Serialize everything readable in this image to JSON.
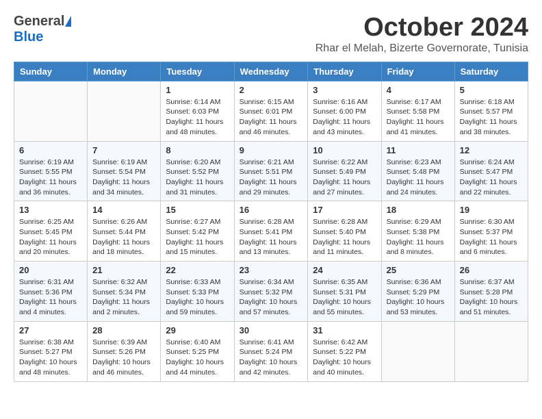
{
  "header": {
    "logo_general": "General",
    "logo_blue": "Blue",
    "month": "October 2024",
    "location": "Rhar el Melah, Bizerte Governorate, Tunisia"
  },
  "weekdays": [
    "Sunday",
    "Monday",
    "Tuesday",
    "Wednesday",
    "Thursday",
    "Friday",
    "Saturday"
  ],
  "weeks": [
    [
      {
        "day": "",
        "info": ""
      },
      {
        "day": "",
        "info": ""
      },
      {
        "day": "1",
        "info": "Sunrise: 6:14 AM\nSunset: 6:03 PM\nDaylight: 11 hours and 48 minutes."
      },
      {
        "day": "2",
        "info": "Sunrise: 6:15 AM\nSunset: 6:01 PM\nDaylight: 11 hours and 46 minutes."
      },
      {
        "day": "3",
        "info": "Sunrise: 6:16 AM\nSunset: 6:00 PM\nDaylight: 11 hours and 43 minutes."
      },
      {
        "day": "4",
        "info": "Sunrise: 6:17 AM\nSunset: 5:58 PM\nDaylight: 11 hours and 41 minutes."
      },
      {
        "day": "5",
        "info": "Sunrise: 6:18 AM\nSunset: 5:57 PM\nDaylight: 11 hours and 38 minutes."
      }
    ],
    [
      {
        "day": "6",
        "info": "Sunrise: 6:19 AM\nSunset: 5:55 PM\nDaylight: 11 hours and 36 minutes."
      },
      {
        "day": "7",
        "info": "Sunrise: 6:19 AM\nSunset: 5:54 PM\nDaylight: 11 hours and 34 minutes."
      },
      {
        "day": "8",
        "info": "Sunrise: 6:20 AM\nSunset: 5:52 PM\nDaylight: 11 hours and 31 minutes."
      },
      {
        "day": "9",
        "info": "Sunrise: 6:21 AM\nSunset: 5:51 PM\nDaylight: 11 hours and 29 minutes."
      },
      {
        "day": "10",
        "info": "Sunrise: 6:22 AM\nSunset: 5:49 PM\nDaylight: 11 hours and 27 minutes."
      },
      {
        "day": "11",
        "info": "Sunrise: 6:23 AM\nSunset: 5:48 PM\nDaylight: 11 hours and 24 minutes."
      },
      {
        "day": "12",
        "info": "Sunrise: 6:24 AM\nSunset: 5:47 PM\nDaylight: 11 hours and 22 minutes."
      }
    ],
    [
      {
        "day": "13",
        "info": "Sunrise: 6:25 AM\nSunset: 5:45 PM\nDaylight: 11 hours and 20 minutes."
      },
      {
        "day": "14",
        "info": "Sunrise: 6:26 AM\nSunset: 5:44 PM\nDaylight: 11 hours and 18 minutes."
      },
      {
        "day": "15",
        "info": "Sunrise: 6:27 AM\nSunset: 5:42 PM\nDaylight: 11 hours and 15 minutes."
      },
      {
        "day": "16",
        "info": "Sunrise: 6:28 AM\nSunset: 5:41 PM\nDaylight: 11 hours and 13 minutes."
      },
      {
        "day": "17",
        "info": "Sunrise: 6:28 AM\nSunset: 5:40 PM\nDaylight: 11 hours and 11 minutes."
      },
      {
        "day": "18",
        "info": "Sunrise: 6:29 AM\nSunset: 5:38 PM\nDaylight: 11 hours and 8 minutes."
      },
      {
        "day": "19",
        "info": "Sunrise: 6:30 AM\nSunset: 5:37 PM\nDaylight: 11 hours and 6 minutes."
      }
    ],
    [
      {
        "day": "20",
        "info": "Sunrise: 6:31 AM\nSunset: 5:36 PM\nDaylight: 11 hours and 4 minutes."
      },
      {
        "day": "21",
        "info": "Sunrise: 6:32 AM\nSunset: 5:34 PM\nDaylight: 11 hours and 2 minutes."
      },
      {
        "day": "22",
        "info": "Sunrise: 6:33 AM\nSunset: 5:33 PM\nDaylight: 10 hours and 59 minutes."
      },
      {
        "day": "23",
        "info": "Sunrise: 6:34 AM\nSunset: 5:32 PM\nDaylight: 10 hours and 57 minutes."
      },
      {
        "day": "24",
        "info": "Sunrise: 6:35 AM\nSunset: 5:31 PM\nDaylight: 10 hours and 55 minutes."
      },
      {
        "day": "25",
        "info": "Sunrise: 6:36 AM\nSunset: 5:29 PM\nDaylight: 10 hours and 53 minutes."
      },
      {
        "day": "26",
        "info": "Sunrise: 6:37 AM\nSunset: 5:28 PM\nDaylight: 10 hours and 51 minutes."
      }
    ],
    [
      {
        "day": "27",
        "info": "Sunrise: 6:38 AM\nSunset: 5:27 PM\nDaylight: 10 hours and 48 minutes."
      },
      {
        "day": "28",
        "info": "Sunrise: 6:39 AM\nSunset: 5:26 PM\nDaylight: 10 hours and 46 minutes."
      },
      {
        "day": "29",
        "info": "Sunrise: 6:40 AM\nSunset: 5:25 PM\nDaylight: 10 hours and 44 minutes."
      },
      {
        "day": "30",
        "info": "Sunrise: 6:41 AM\nSunset: 5:24 PM\nDaylight: 10 hours and 42 minutes."
      },
      {
        "day": "31",
        "info": "Sunrise: 6:42 AM\nSunset: 5:22 PM\nDaylight: 10 hours and 40 minutes."
      },
      {
        "day": "",
        "info": ""
      },
      {
        "day": "",
        "info": ""
      }
    ]
  ]
}
